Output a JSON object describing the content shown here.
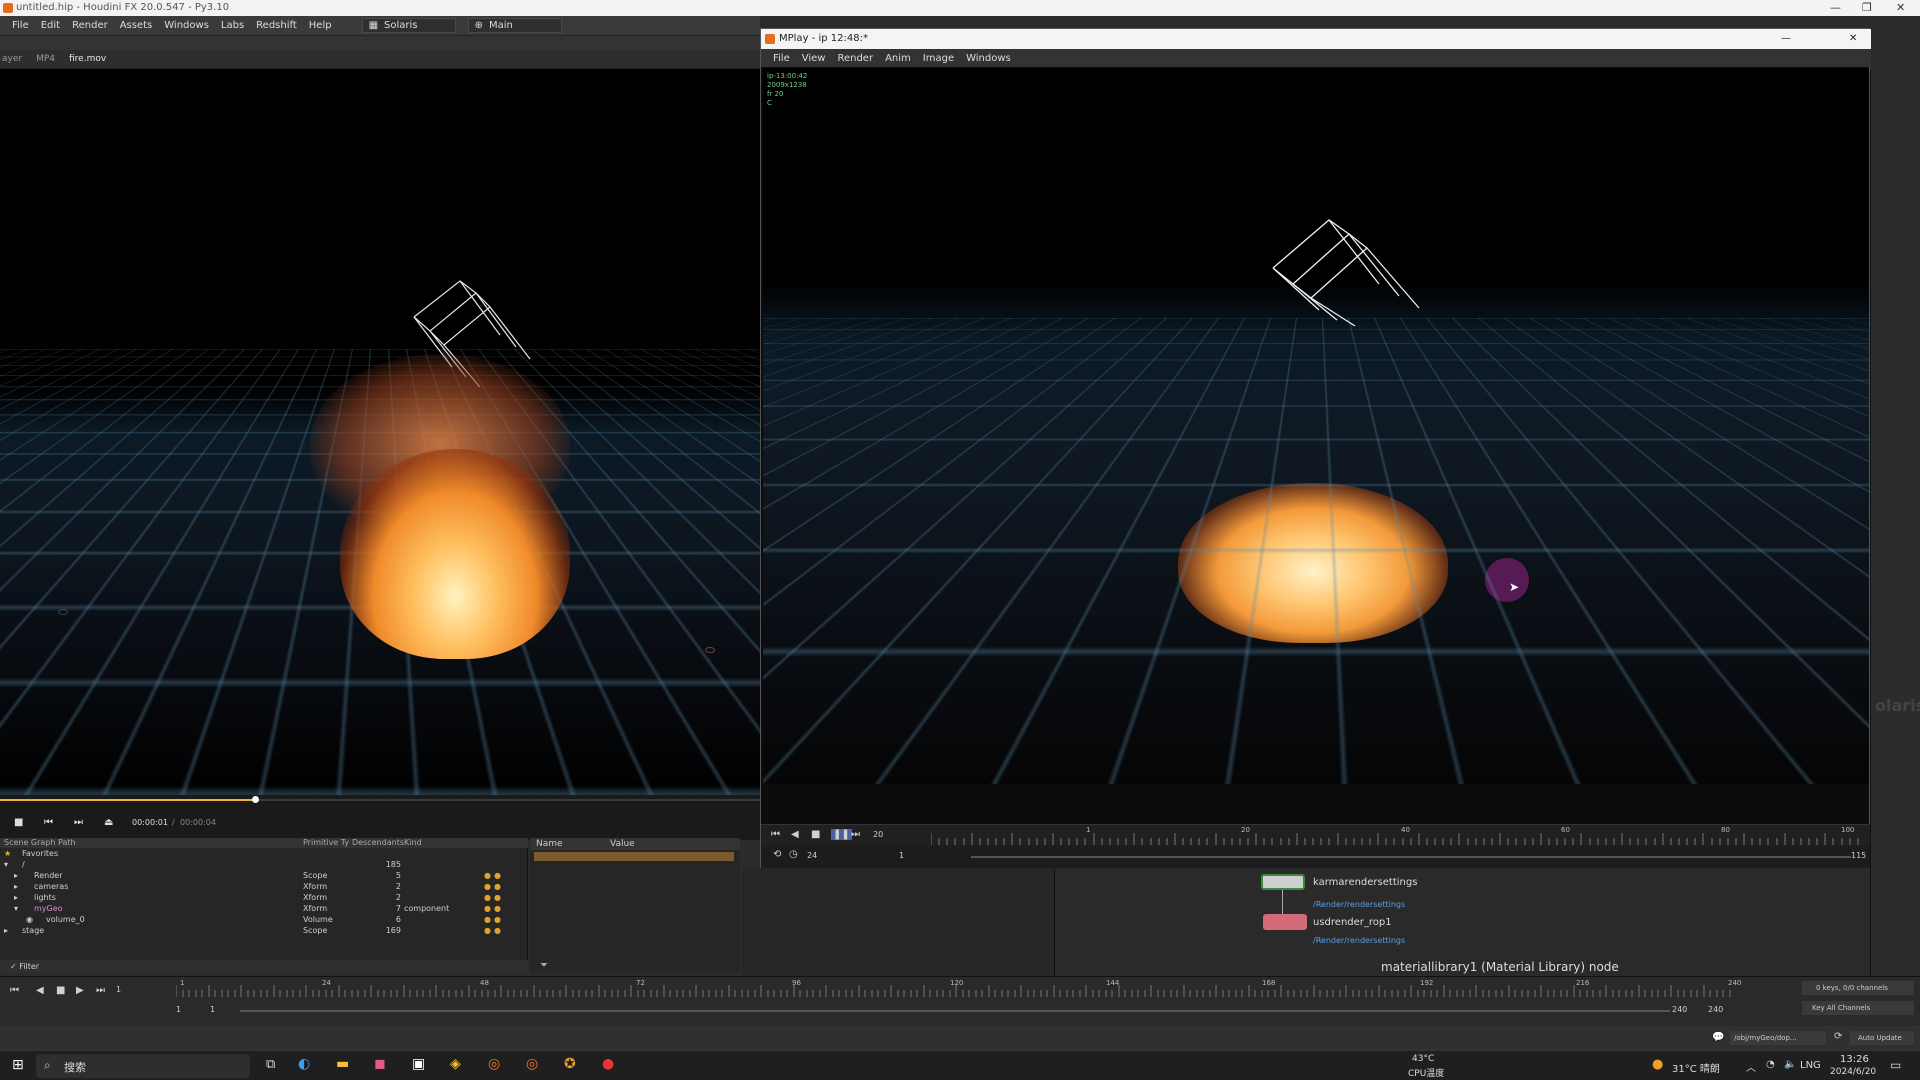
{
  "window": {
    "title": "untitled.hip - Houdini FX 20.0.547 - Py3.10"
  },
  "menubar": {
    "items": [
      "File",
      "Edit",
      "Render",
      "Assets",
      "Windows",
      "Labs",
      "Redshift",
      "Help"
    ],
    "desktop": "Solaris",
    "context": "Main"
  },
  "viewer": {
    "tabs": [
      "ayer",
      "MP4",
      "fire.mov"
    ],
    "time_current": "00:00:01",
    "time_total": "00:00:04"
  },
  "scene_graph": {
    "header": "Scene Graph Path",
    "col_primitive": "Primitive Ty",
    "col_descendants": "Descendants",
    "col_kind": "Kind",
    "favorites": "Favorites",
    "root_path": "/",
    "root_count": "185",
    "rows": [
      {
        "name": "Render",
        "type": "Scope",
        "count": "5",
        "kind": ""
      },
      {
        "name": "cameras",
        "type": "Xform",
        "count": "2",
        "kind": ""
      },
      {
        "name": "lights",
        "type": "Xform",
        "count": "2",
        "kind": ""
      },
      {
        "name": "myGeo",
        "type": "Xform",
        "count": "7",
        "kind": "component"
      },
      {
        "name": "volume_0",
        "type": "Volume",
        "count": "6",
        "kind": ""
      },
      {
        "name": "stage",
        "type": "Scope",
        "count": "169",
        "kind": ""
      }
    ],
    "filter": "Filter"
  },
  "properties": {
    "col_name": "Name",
    "col_value": "Value"
  },
  "mplay": {
    "title": "MPlay - ip 12:48:*",
    "menu": [
      "File",
      "View",
      "Render",
      "Anim",
      "Image",
      "Windows"
    ],
    "info": [
      "ip-13:00:42",
      "2009x1238",
      "fr 20",
      "C"
    ],
    "frame": "20",
    "fps": "24",
    "range_start": "1",
    "range_end": "115",
    "ruler_ticks": [
      "1",
      "20",
      "40",
      "60",
      "80",
      "100"
    ]
  },
  "network": {
    "node1": "karmarendersettings",
    "node1_path": "/Render/rendersettings",
    "node2": "usdrender_rop1",
    "node2_path": "/Render/rendersettings",
    "status": "materiallibrary1 (Material Library) node"
  },
  "timeline": {
    "frame": "1",
    "ticks": [
      "1",
      "24",
      "48",
      "72",
      "96",
      "120",
      "144",
      "168",
      "192",
      "216",
      "240"
    ],
    "start": "1",
    "range_start": "1",
    "end": "240",
    "end2": "240",
    "keys": "0 keys, 0/0 channels",
    "key_all": "Key All Channels",
    "auto_update": "Auto Update",
    "path": "/obj/myGeo/dop..."
  },
  "right_panel": {
    "label": "olaris"
  },
  "taskbar": {
    "search": "搜索",
    "cpu_temp": "43°C",
    "cpu_label": "CPU温度",
    "weather": "31°C 晴朗",
    "lang": "LNG",
    "time": "13:26",
    "date": "2024/6/20"
  }
}
